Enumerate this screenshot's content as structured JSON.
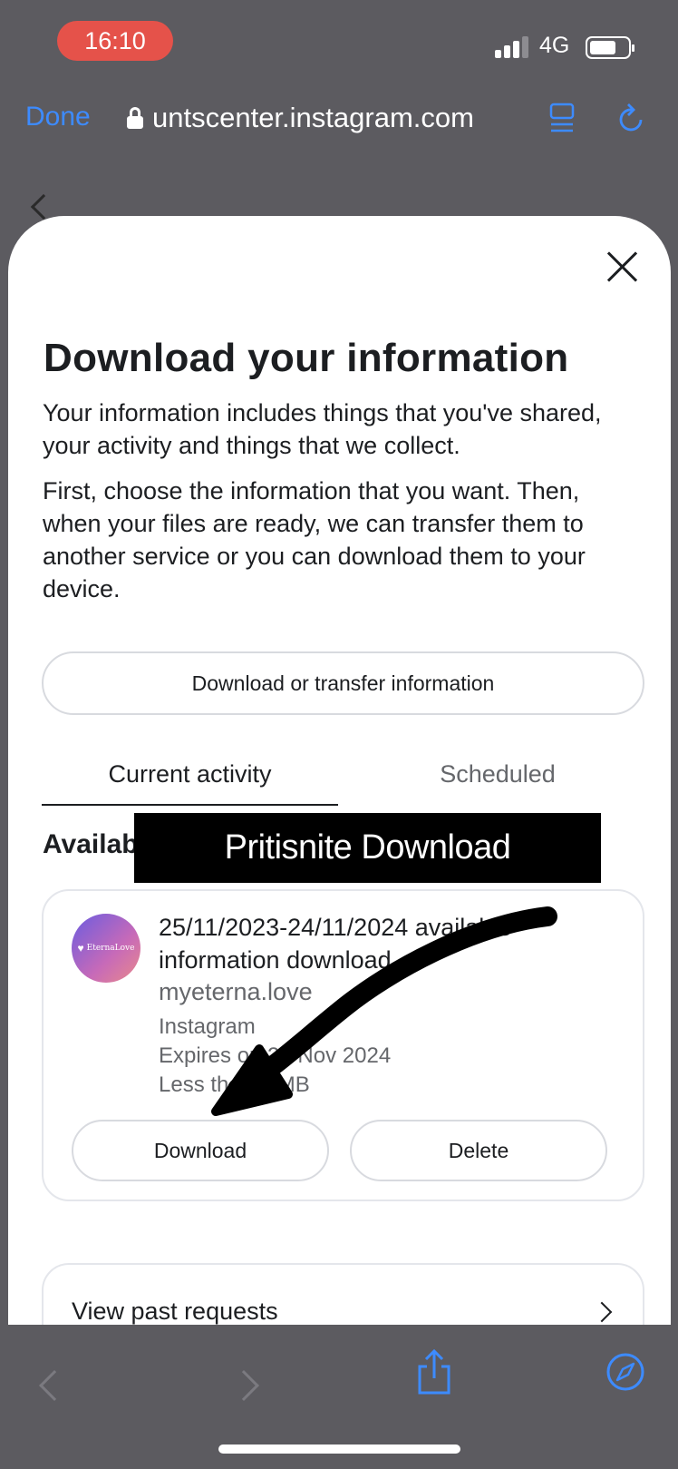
{
  "status_bar": {
    "time": "16:10",
    "network": "4G"
  },
  "browser": {
    "done_label": "Done",
    "url": "untscenter.instagram.com"
  },
  "sheet": {
    "title": "Download your information",
    "paragraph1": "Your information includes things that you've shared, your activity and things that we collect.",
    "paragraph2": "First, choose the information that you want. Then, when your files are ready, we can transfer them to another service or you can download them to your device.",
    "transfer_button": "Download or transfer information",
    "tabs": [
      {
        "label": "Current activity",
        "active": true
      },
      {
        "label": "Scheduled",
        "active": false
      }
    ],
    "section_label": "Availab",
    "request_card": {
      "avatar_brand": "EternaLove",
      "title": "25/11/2023-24/11/2024 available information download",
      "site": "myeterna.love",
      "platform": "Instagram",
      "expires": "Expires on 28 Nov 2024",
      "size": "Less than 1 MB",
      "download_label": "Download",
      "delete_label": "Delete"
    },
    "past_requests_label": "View past requests"
  },
  "overlay": {
    "banner_text": "Pritisnite Download"
  },
  "colors": {
    "accent": "#3d8bff",
    "time_pill": "#e5524a",
    "text": "#1c1e21",
    "secondary": "#65676b"
  }
}
